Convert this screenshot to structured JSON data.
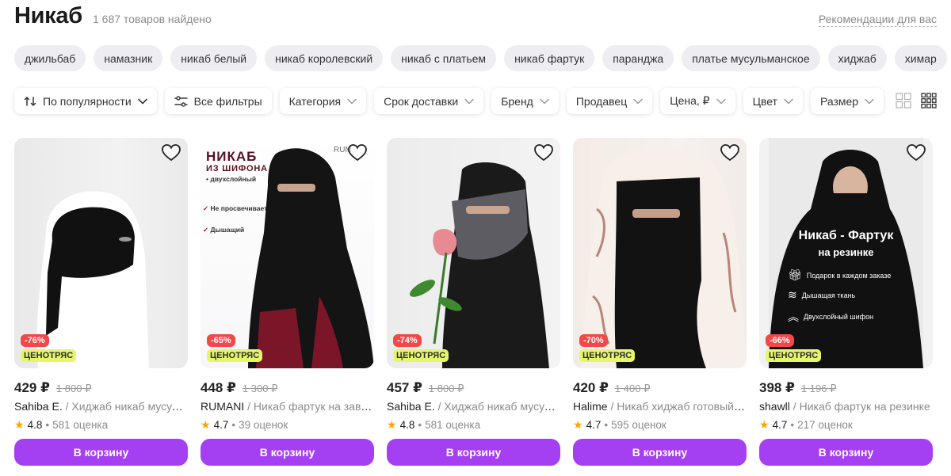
{
  "header": {
    "title": "Никаб",
    "count": "1 687 товаров найдено",
    "recommendations": "Рекомендации для вас"
  },
  "chips": [
    "джильбаб",
    "намазник",
    "никаб белый",
    "никаб королевский",
    "никаб с платьем",
    "никаб фартук",
    "паранджа",
    "платье мусульманское",
    "хиджаб",
    "химар"
  ],
  "filters": {
    "sort": "По популярности",
    "all": "Все фильтры",
    "items": [
      "Категория",
      "Срок доставки",
      "Бренд",
      "Продавец",
      "Цена, ₽",
      "Цвет",
      "Размер"
    ]
  },
  "products": [
    {
      "price": "429 ₽",
      "old_price": "1 800 ₽",
      "discount": "-76%",
      "promo": "ЦЕНОТРЯС",
      "brand": "Sahiba E.",
      "name": "Хиджаб никаб мусульманский",
      "rating": "4.8",
      "reviews": "581 оценка",
      "cart": "В корзину",
      "image_text": []
    },
    {
      "price": "448 ₽",
      "old_price": "1 300 ₽",
      "discount": "-65%",
      "promo": "ЦЕНОТРЯС",
      "brand": "RUMANI",
      "name": "Никаб фартук на завязках",
      "rating": "4.7",
      "reviews": "39 оценок",
      "cart": "В корзину",
      "image_text": [
        "НИКАБ",
        "ИЗ ШИФОНА",
        "• двухслойный",
        "Не просвечивает",
        "Дышащий",
        "RUM"
      ]
    },
    {
      "price": "457 ₽",
      "old_price": "1 800 ₽",
      "discount": "-74%",
      "promo": "ЦЕНОТРЯС",
      "brand": "Sahiba E.",
      "name": "Хиджаб никаб мусульманский",
      "rating": "4.8",
      "reviews": "581 оценка",
      "cart": "В корзину",
      "image_text": []
    },
    {
      "price": "420 ₽",
      "old_price": "1 400 ₽",
      "discount": "-70%",
      "promo": "ЦЕНОТРЯС",
      "brand": "Halime",
      "name": "Никаб хиджаб готовый мусульманский",
      "rating": "4.7",
      "reviews": "595 оценок",
      "cart": "В корзину",
      "image_text": []
    },
    {
      "price": "398 ₽",
      "old_price": "1 196 ₽",
      "discount": "-66%",
      "promo": "ЦЕНОТРЯС",
      "brand": "shawll",
      "name": "Никаб фартук на резинке",
      "rating": "4.7",
      "reviews": "217 оценок",
      "cart": "В корзину",
      "image_text": [
        "Никаб - Фартук",
        "на резинке",
        "Подарок в каждом заказе",
        "Дышащая ткань",
        "Двухслойный шифон"
      ]
    }
  ],
  "colors": {
    "accent": "#a540f2",
    "discount": "#f24848",
    "promo": "#e6f56a",
    "star": "#ffa500"
  },
  "icons": [
    "sort-icon",
    "filters-icon",
    "chevron-down-icon",
    "grid-large-icon",
    "grid-small-icon",
    "heart-icon",
    "star-icon"
  ]
}
